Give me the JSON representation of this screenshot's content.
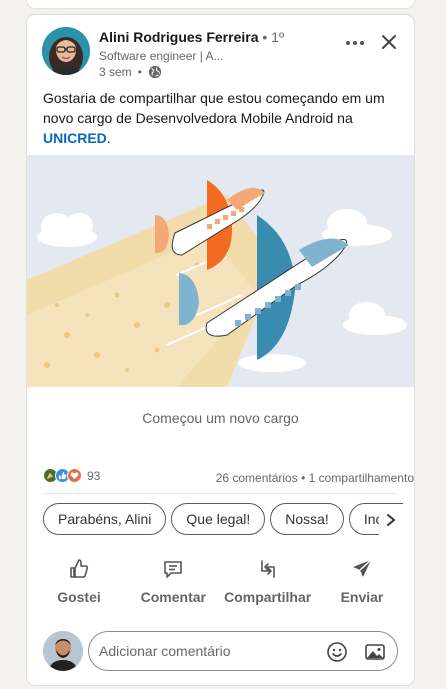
{
  "post": {
    "author_name": "Alini Rodrigues Ferreira",
    "degree": " • 1º",
    "subtitle": "Software engineer | A...",
    "time": "3 sem",
    "time_sep": "•",
    "text_part1": "Gostaria de compartilhar que estou começando em um novo cargo de Desenvolvedora Mobile Android na ",
    "mention": "UNICRED",
    "text_part2": ".",
    "card_caption": "Começou um novo cargo"
  },
  "social": {
    "reaction_count": "93",
    "stats": "26 comentários • 1 compartilhamento"
  },
  "quick_replies": [
    "Parabéns, Alini",
    "Que legal!",
    "Nossa!",
    "Incrível"
  ],
  "actions": {
    "like": "Gostei",
    "comment": "Comentar",
    "share": "Compartilhar",
    "send": "Enviar"
  },
  "comment": {
    "placeholder": "Adicionar comentário"
  },
  "colors": {
    "link": "#0a66c2",
    "orange": "#f26b21",
    "blue": "#3a8bb0",
    "sky": "#e4e8f1"
  }
}
